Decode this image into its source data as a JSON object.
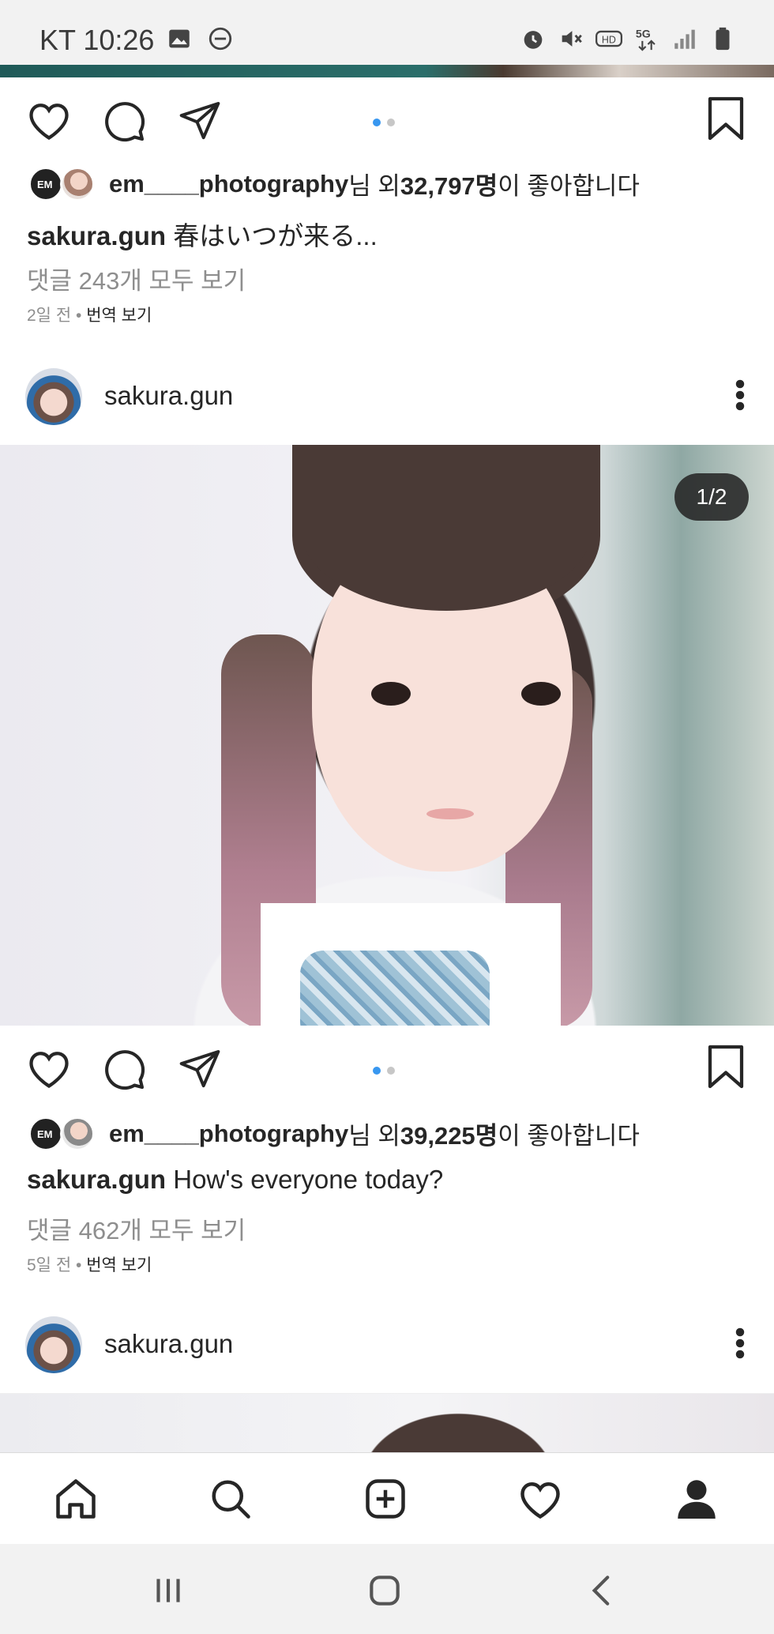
{
  "status_bar": {
    "time": "KT 10:26",
    "left_icons": [
      "image-icon",
      "do-not-disturb-icon"
    ],
    "right_icons": [
      "alarm-icon",
      "mute-icon",
      "hd-icon",
      "5g-icon",
      "signal-icon",
      "battery-icon"
    ]
  },
  "posts": [
    {
      "likes": {
        "prefix_user": "em____photography",
        "mid": "님 외 ",
        "count": "32,797명",
        "suffix": "이 좋아합니다"
      },
      "caption": {
        "user": "sakura.gun",
        "text": "春はいつが来る..."
      },
      "comments_link": "댓글 243개 모두 보기",
      "time": "2일 전",
      "separator": " • ",
      "translate": "번역 보기"
    },
    {
      "header_user": "sakura.gun",
      "image_counter": "1/2",
      "likes": {
        "prefix_user": "em____photography",
        "mid": "님 외 ",
        "count": "39,225명",
        "suffix": "이 좋아합니다"
      },
      "caption": {
        "user": "sakura.gun",
        "text": "How's everyone today?"
      },
      "comments_link": "댓글 462개 모두 보기",
      "time": "5일 전",
      "separator": " • ",
      "translate": "번역 보기"
    },
    {
      "header_user": "sakura.gun"
    }
  ],
  "bottom_nav": [
    "home-icon",
    "search-icon",
    "new-post-icon",
    "activity-icon",
    "profile-icon"
  ],
  "system_nav": [
    "recents-icon",
    "home-button-icon",
    "back-icon"
  ],
  "colors": {
    "accent": "#3897f0",
    "muted": "#8e8e8e",
    "text": "#262626"
  }
}
